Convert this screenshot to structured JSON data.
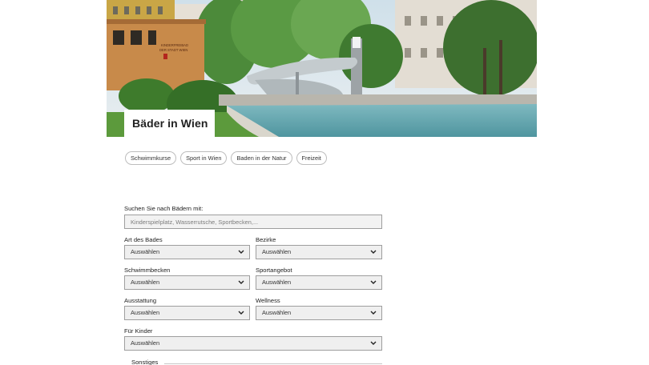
{
  "hero": {
    "title": "Bäder in Wien",
    "sign_text": [
      "KINDERFREIBAD",
      "DER STADT WIEN"
    ]
  },
  "tags": [
    "Schwimmkurse",
    "Sport in Wien",
    "Baden in der Natur",
    "Freizeit"
  ],
  "search": {
    "label": "Suchen Sie nach Bädern mit:",
    "placeholder": "Kinderspielplatz, Wasserrutsche, Sportbecken,..."
  },
  "filters": {
    "art_des_bades": {
      "label": "Art des Bades",
      "value": "Auswählen"
    },
    "bezirke": {
      "label": "Bezirke",
      "value": "Auswählen"
    },
    "schwimmbecken": {
      "label": "Schwimmbecken",
      "value": "Auswählen"
    },
    "sportangebot": {
      "label": "Sportangebot",
      "value": "Auswählen"
    },
    "ausstattung": {
      "label": "Ausstattung",
      "value": "Auswählen"
    },
    "wellness": {
      "label": "Wellness",
      "value": "Auswählen"
    },
    "fuer_kinder": {
      "label": "Für Kinder",
      "value": "Auswählen"
    }
  },
  "sonstiges": {
    "label": "Sonstiges"
  },
  "icons": {
    "select_chevron": "chevron-down-icon"
  },
  "colors": {
    "pool_water": "#5fa6b0",
    "tag_border": "#bdbdbd",
    "select_bg": "#efefef"
  }
}
